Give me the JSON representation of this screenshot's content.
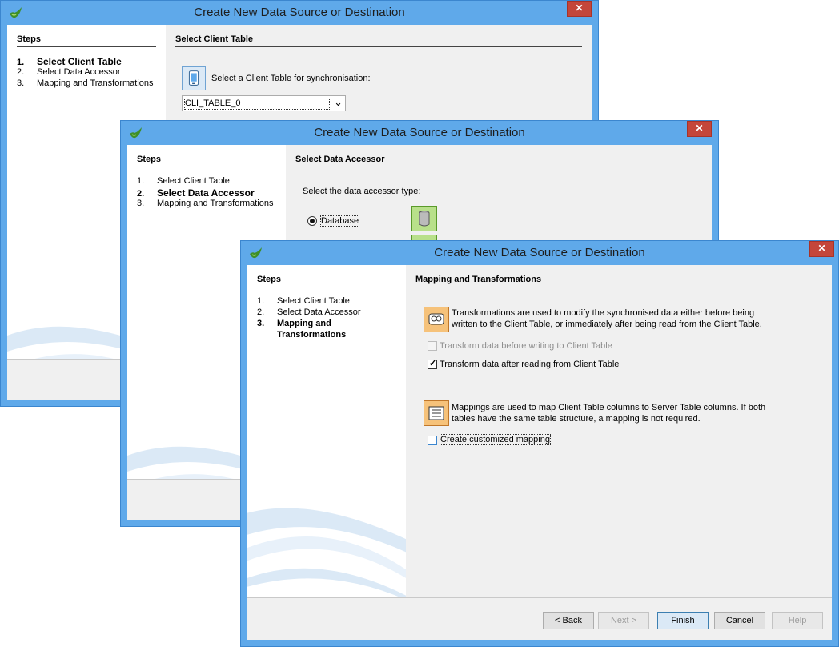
{
  "window_title": "Create New Data Source or Destination",
  "close_glyph": "✕",
  "steps_header": "Steps",
  "steps": [
    {
      "num": "1.",
      "label": "Select Client Table"
    },
    {
      "num": "2.",
      "label": "Select Data Accessor"
    },
    {
      "num": "3.",
      "label": "Mapping and Transformations"
    }
  ],
  "win1": {
    "section_title": "Select Client Table",
    "prompt": "Select a Client Table for synchronisation:",
    "combo_value": "CLI_TABLE_0",
    "combo_arrow": "⌄"
  },
  "win2": {
    "section_title": "Select Data Accessor",
    "prompt": "Select the data accessor type:",
    "radio_database": "Database"
  },
  "win3": {
    "section_title": "Mapping and Transformations",
    "step3_line1": "Mapping and",
    "step3_line2": "Transformations",
    "transform_desc_1": "Transformations are used to modify the synchronised data either before being",
    "transform_desc_2": "written to the Client Table, or immediately after being read from the Client Table.",
    "cb_before": "Transform data before writing to Client Table",
    "cb_after": "Transform data after reading from Client Table",
    "cb_after_mark": "✓",
    "mapping_desc_1": "Mappings are used to map Client Table columns to Server Table columns. If both",
    "mapping_desc_2": "tables have the same table structure, a mapping is not required.",
    "cb_custom": "Create customized mapping",
    "buttons": {
      "back": "< Back",
      "next": "Next >",
      "finish": "Finish",
      "cancel": "Cancel",
      "help": "Help"
    }
  }
}
